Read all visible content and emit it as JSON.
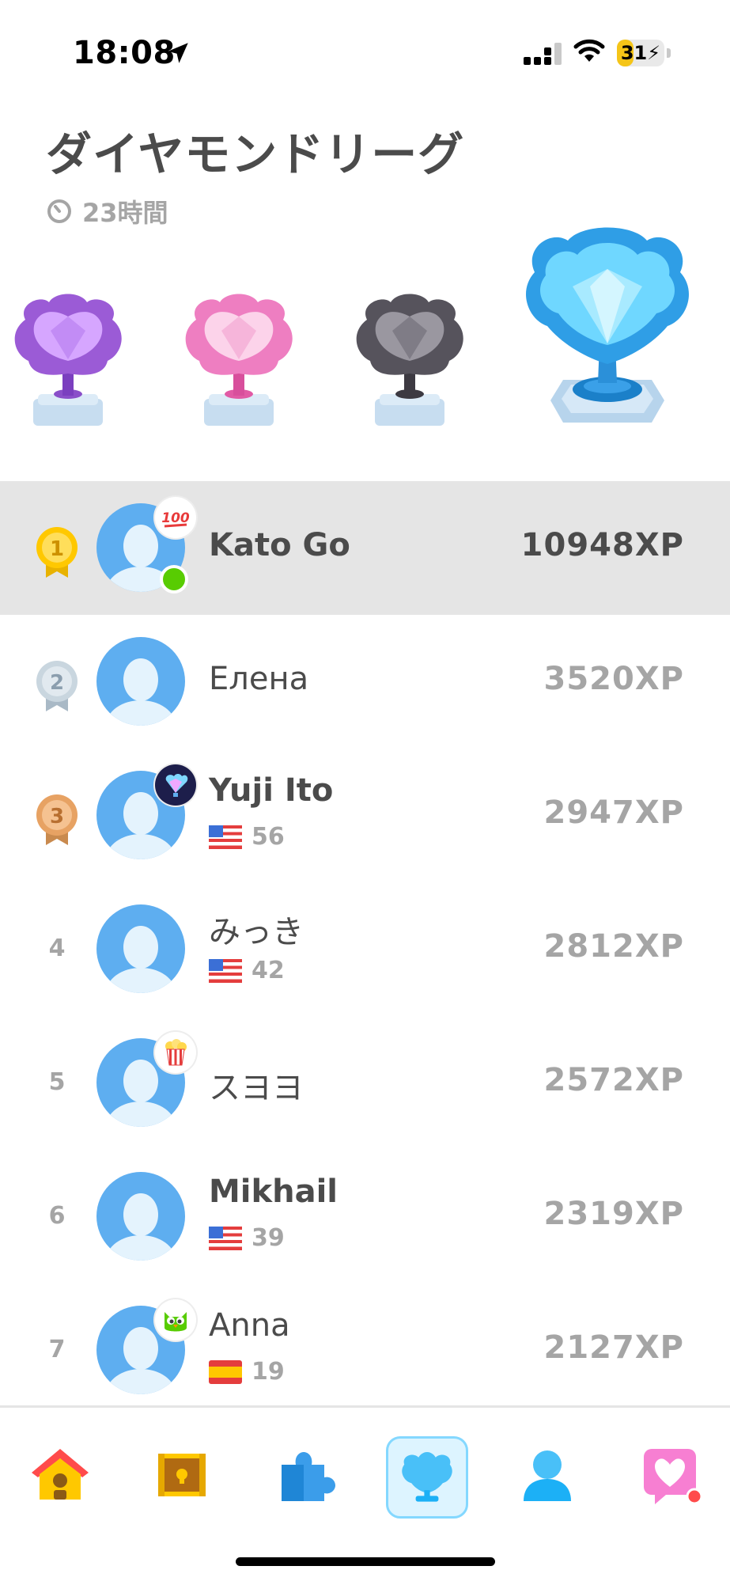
{
  "status_bar": {
    "time": "18:08",
    "battery": "31",
    "battery_level": 0.31
  },
  "header": {
    "title": "ダイヤモンドリーグ",
    "time_left": "23時間"
  },
  "leaderboard": [
    {
      "rank": "1",
      "name": "Kato Go",
      "xp": "10948XP",
      "badge": "hundred-points-icon",
      "online": true,
      "highlight": true
    },
    {
      "rank": "2",
      "name": "Елена",
      "xp": "3520XP"
    },
    {
      "rank": "3",
      "name": "Yuji Ito",
      "xp": "2947XP",
      "flag": "us-flag-icon",
      "streak": "56",
      "badge": "diamond-league-icon"
    },
    {
      "rank": "4",
      "name": "みっき",
      "xp": "2812XP",
      "flag": "us-flag-icon",
      "streak": "42"
    },
    {
      "rank": "5",
      "name": "スヨヨ",
      "xp": "2572XP",
      "badge": "popcorn-icon"
    },
    {
      "rank": "6",
      "name": "Mikhail",
      "xp": "2319XP",
      "flag": "us-flag-icon",
      "streak": "39"
    },
    {
      "rank": "7",
      "name": "Anna",
      "xp": "2127XP",
      "flag": "spain-flag-icon",
      "streak": "19",
      "badge": "owl-icon"
    }
  ],
  "nav": [
    {
      "icon": "home-icon"
    },
    {
      "icon": "treasure-chest-icon"
    },
    {
      "icon": "puzzle-icon"
    },
    {
      "icon": "leaderboard-icon",
      "active": true
    },
    {
      "icon": "profile-icon"
    },
    {
      "icon": "heart-shop-icon",
      "notification": true
    }
  ],
  "colors": {
    "highlight_row": "#e5e5e5",
    "avatar": "#5eaef0",
    "gold": "#ffc800",
    "silver": "#c9d6df",
    "bronze": "#e7a263",
    "online": "#58cc02",
    "active_tab": "#ddf4ff"
  }
}
